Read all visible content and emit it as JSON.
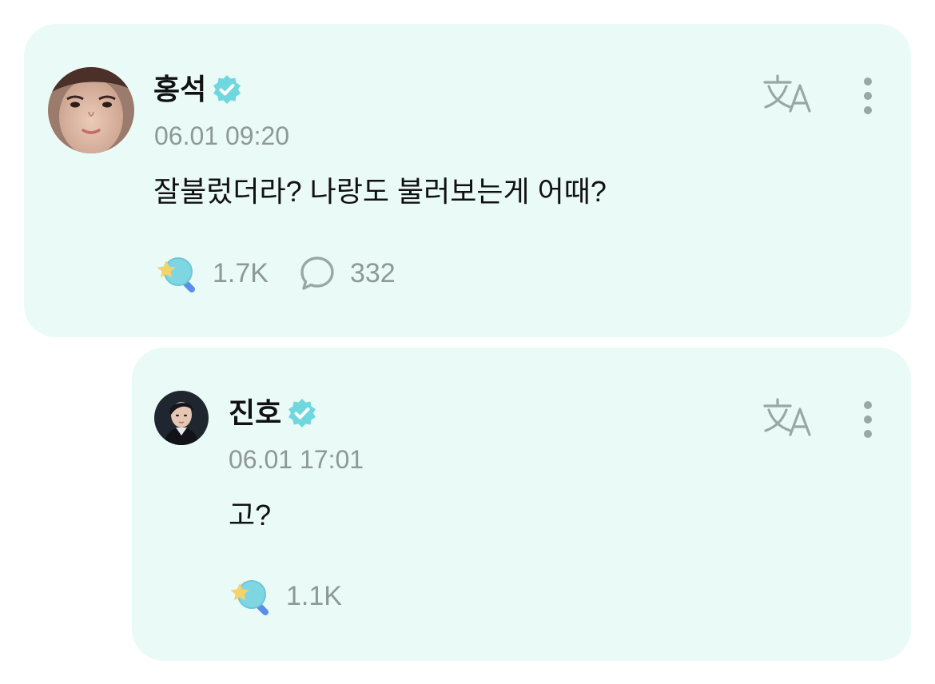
{
  "colors": {
    "card_background": "#eafaf7",
    "verified_badge": "#6fd8df",
    "muted_text": "#8e9894",
    "icon_gray": "#98a8a3"
  },
  "icons": {
    "verified": "verified-badge-icon",
    "translate": "translate-icon",
    "more": "kebab-menu-icon",
    "cheer": "star-wand-icon",
    "comment": "speech-bubble-icon"
  },
  "post": {
    "author": "홍석",
    "timestamp": "06.01 09:20",
    "text": "잘불렀더라? 나랑도 불러보는게 어때?",
    "cheer_count": "1.7K",
    "comment_count": "332"
  },
  "reply": {
    "author": "진호",
    "timestamp": "06.01 17:01",
    "text": "고?",
    "cheer_count": "1.1K"
  }
}
